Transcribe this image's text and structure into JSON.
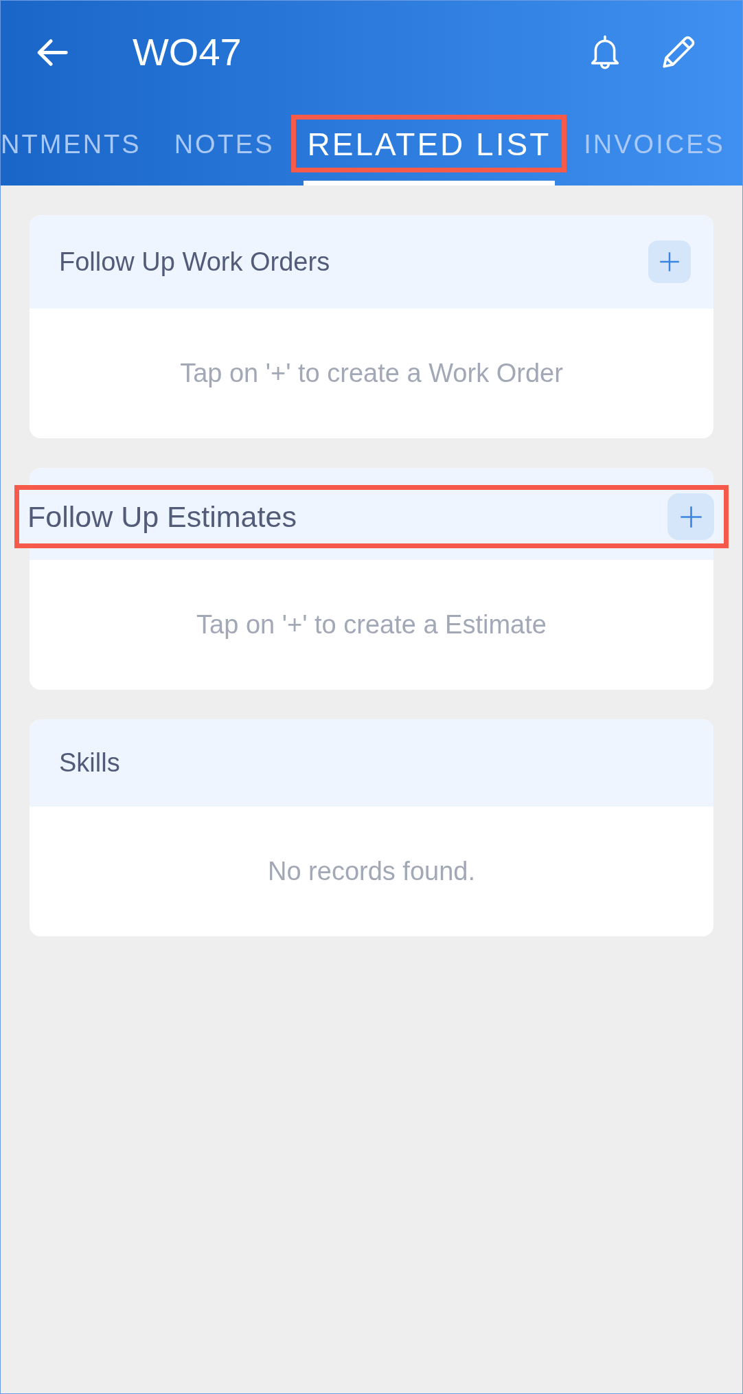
{
  "header": {
    "title": "WO47"
  },
  "tabs": [
    {
      "label": "NTMENTS",
      "selected": false,
      "highlighted": false
    },
    {
      "label": "NOTES",
      "selected": false,
      "highlighted": false
    },
    {
      "label": "RELATED LIST",
      "selected": true,
      "highlighted": true
    },
    {
      "label": "INVOICES",
      "selected": false,
      "highlighted": false
    }
  ],
  "sections": [
    {
      "title": "Follow Up Work Orders",
      "can_add": true,
      "highlighted": false,
      "empty_message": "Tap on '+' to create a Work Order"
    },
    {
      "title": "Follow Up Estimates",
      "can_add": true,
      "highlighted": true,
      "empty_message": "Tap on '+' to create a Estimate"
    },
    {
      "title": "Skills",
      "can_add": false,
      "highlighted": false,
      "empty_message": "No records found."
    }
  ]
}
